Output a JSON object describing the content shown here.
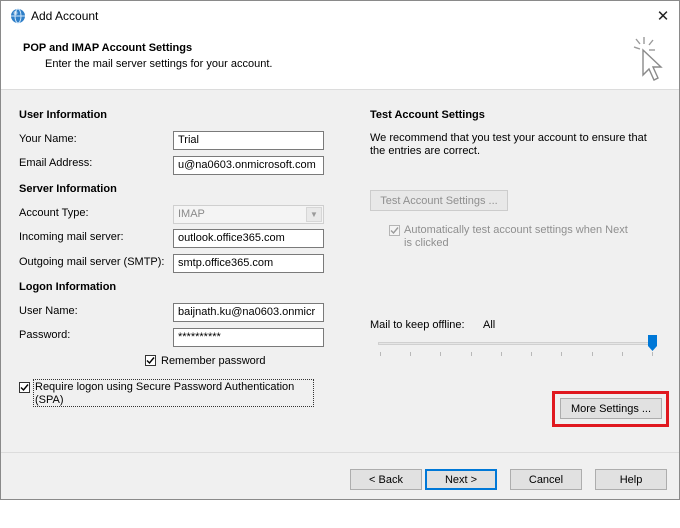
{
  "window": {
    "title": "Add Account",
    "close_symbol": "✕"
  },
  "header": {
    "title": "POP and IMAP Account Settings",
    "subtitle": "Enter the mail server settings for your account."
  },
  "user_info": {
    "heading": "User Information",
    "name_label": "Your Name:",
    "name_value": "Trial",
    "email_label": "Email Address:",
    "email_value": "u@na0603.onmicrosoft.com"
  },
  "server_info": {
    "heading": "Server Information",
    "account_type_label": "Account Type:",
    "account_type_value": "IMAP",
    "incoming_label": "Incoming mail server:",
    "incoming_value": "outlook.office365.com",
    "outgoing_label": "Outgoing mail server (SMTP):",
    "outgoing_value": "smtp.office365.com"
  },
  "logon_info": {
    "heading": "Logon Information",
    "username_label": "User Name:",
    "username_value": "baijnath.ku@na0603.onmicr",
    "password_label": "Password:",
    "password_value": "**********",
    "remember_label": "Remember password",
    "remember_checked": true,
    "spa_label_line1": "Require logon using Secure Password Authentication",
    "spa_label_line2": "(SPA)",
    "spa_checked": true
  },
  "test_settings": {
    "heading": "Test Account Settings",
    "description_line1": "We recommend that you test your account to ensure that",
    "description_line2": "the entries are correct.",
    "test_button": "Test Account Settings ...",
    "auto_test_line1": "Automatically test account settings when Next",
    "auto_test_line2": "is clicked",
    "auto_test_checked": true
  },
  "offline": {
    "label": "Mail to keep offline:",
    "value": "All",
    "slider_position_fraction": 1.0
  },
  "more_settings_button": "More Settings ...",
  "footer": {
    "back": "< Back",
    "next": "Next >",
    "cancel": "Cancel",
    "help": "Help"
  },
  "colors": {
    "highlight_border": "#e0181f",
    "accent": "#0078d7",
    "dialog_bg": "#f0f0f0"
  },
  "icons": [
    "outlook-globe-icon",
    "close-icon",
    "cursor-click-icon",
    "checkmark-icon",
    "dropdown-arrow-icon",
    "slider-thumb-icon"
  ]
}
